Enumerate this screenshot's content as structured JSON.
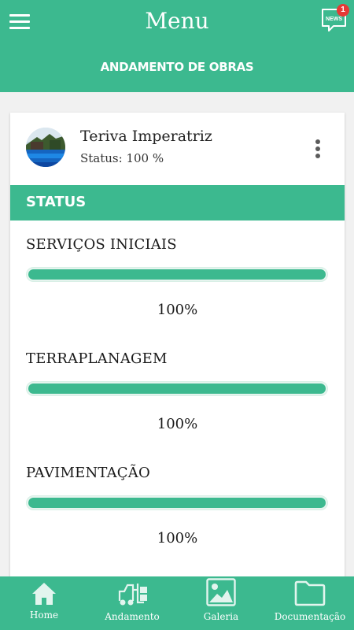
{
  "header": {
    "title": "Menu",
    "subtitle": "ANDAMENTO DE OBRAS",
    "news_icon_text": "NEWS",
    "news_badge": "1"
  },
  "project": {
    "name": "Teriva Imperatriz",
    "status_text": "Status: 100 %"
  },
  "section": {
    "title": "STATUS"
  },
  "stages": [
    {
      "label": "SERVIÇOS INICIAIS",
      "percent_text": "100%",
      "progress": 1.0
    },
    {
      "label": "TERRAPLANAGEM",
      "percent_text": "100%",
      "progress": 1.0
    },
    {
      "label": "PAVIMENTAÇÃO",
      "percent_text": "100%",
      "progress": 1.0
    }
  ],
  "nav": {
    "items": [
      {
        "label": "Home",
        "icon": "home-icon"
      },
      {
        "label": "Andamento",
        "icon": "forklift-icon"
      },
      {
        "label": "Galeria",
        "icon": "image-icon"
      },
      {
        "label": "Documentação",
        "icon": "folder-icon"
      }
    ]
  },
  "colors": {
    "primary": "#3cb98f",
    "badge": "#e53935",
    "bar_track": "#e5f4ee"
  }
}
